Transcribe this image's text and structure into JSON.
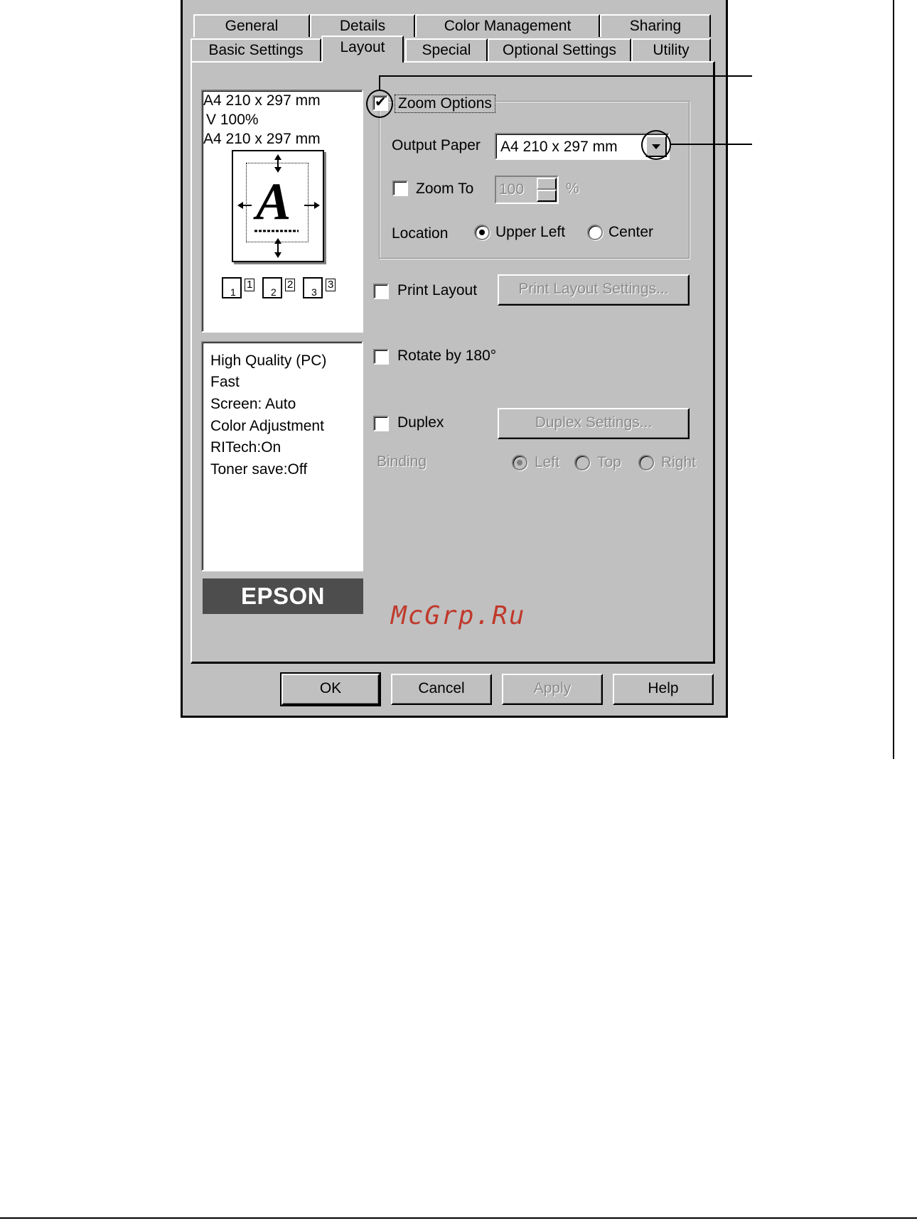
{
  "tabs": {
    "row_back": [
      "General",
      "Details",
      "Color Management",
      "Sharing"
    ],
    "row_front": [
      "Basic Settings",
      "Layout",
      "Special",
      "Optional Settings",
      "Utility"
    ],
    "active": "Layout"
  },
  "preview": {
    "paper_line1": "A4 210 x 297 mm",
    "paper_line2": "V 100%",
    "paper_line3": "A4 210 x 297 mm",
    "page_letter": "A",
    "mini_pages": [
      "1",
      "2",
      "3"
    ],
    "mini_superscripts": [
      "1",
      "2",
      "3"
    ]
  },
  "summary": {
    "lines": [
      "High Quality (PC)",
      "Fast",
      "Screen: Auto",
      "Color Adjustment",
      "RITech:On",
      "Toner save:Off"
    ]
  },
  "logo": "EPSON",
  "zoom_options": {
    "label": "Zoom Options",
    "checked": true,
    "output_paper_label": "Output Paper",
    "output_paper_value": "A4 210 x 297 mm",
    "zoom_to_label": "Zoom To",
    "zoom_to_checked": false,
    "zoom_value": "100",
    "zoom_unit": "%",
    "location_label": "Location",
    "location_options": [
      "Upper Left",
      "Center"
    ],
    "location_selected": "Upper Left"
  },
  "print_layout": {
    "label": "Print Layout",
    "checked": false,
    "settings_button": "Print Layout Settings..."
  },
  "rotate": {
    "label": "Rotate by 180°",
    "checked": false
  },
  "duplex": {
    "label": "Duplex",
    "checked": false,
    "settings_button": "Duplex Settings...",
    "binding_label": "Binding",
    "binding_options": [
      "Left",
      "Top",
      "Right"
    ],
    "binding_selected": "Left"
  },
  "buttons": {
    "ok": "OK",
    "cancel": "Cancel",
    "apply": "Apply",
    "help": "Help"
  },
  "watermark": "McGrp.Ru"
}
